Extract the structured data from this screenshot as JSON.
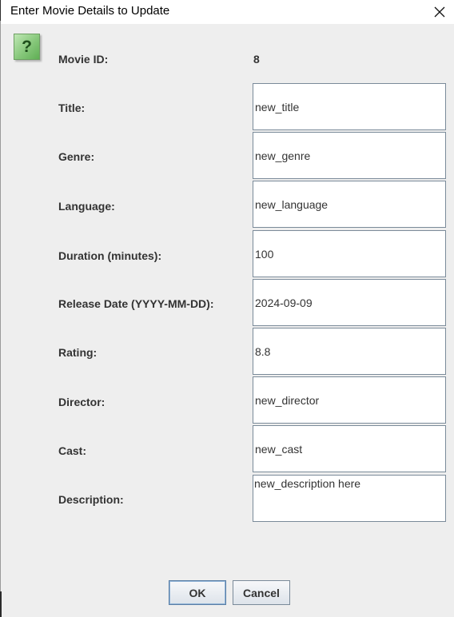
{
  "window": {
    "title": "Enter Movie Details to Update",
    "close_glyph": "✕"
  },
  "dialog_icon": {
    "name": "question-icon",
    "glyph": "?"
  },
  "movie_id": {
    "label": "Movie ID:",
    "value": "8"
  },
  "fields": {
    "title": {
      "label": "Title:",
      "value": "new_title"
    },
    "genre": {
      "label": "Genre:",
      "value": "new_genre"
    },
    "language": {
      "label": "Language:",
      "value": "new_language"
    },
    "duration": {
      "label": "Duration (minutes):",
      "value": "100"
    },
    "release_date": {
      "label": "Release Date (YYYY-MM-DD):",
      "value": "2024-09-09"
    },
    "rating": {
      "label": "Rating:",
      "value": "8.8"
    },
    "director": {
      "label": "Director:",
      "value": "new_director"
    },
    "cast": {
      "label": "Cast:",
      "value": "new_cast"
    },
    "description": {
      "label": "Description:",
      "value": "new_description here"
    }
  },
  "buttons": {
    "ok": "OK",
    "cancel": "Cancel"
  }
}
